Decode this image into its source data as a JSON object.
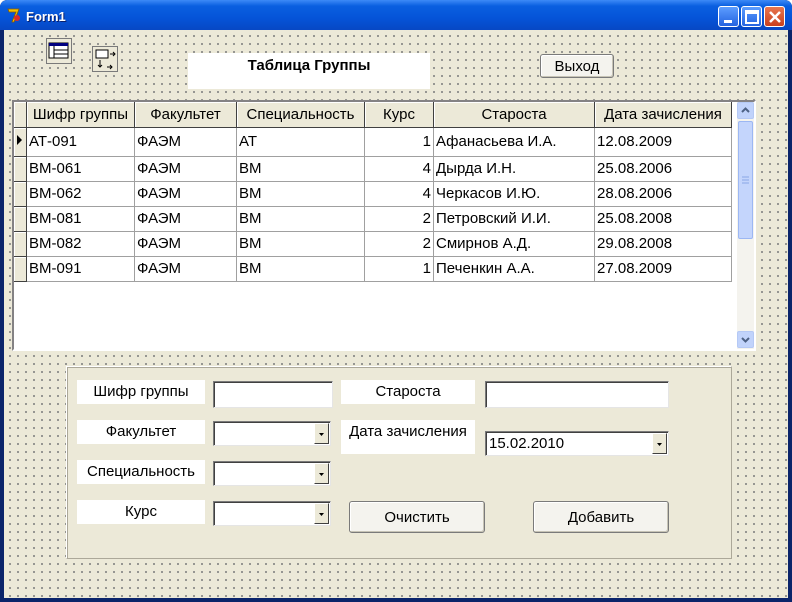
{
  "window": {
    "title": "Form1"
  },
  "toolbar": {
    "icons": [
      "table-view-icon",
      "swap-arrows-icon"
    ]
  },
  "header": {
    "title": "Таблица Группы",
    "exit_label": "Выход"
  },
  "grid": {
    "columns": [
      "Шифр группы",
      "Факультет",
      "Специальность",
      "Курс",
      "Староста",
      "Дата зачисления"
    ],
    "rows": [
      [
        "АТ-091",
        "ФАЭМ",
        "АТ",
        "1",
        "Афанасьева И.А.",
        "12.08.2009"
      ],
      [
        "ВМ-061",
        "ФАЭМ",
        "ВМ",
        "4",
        "Дырда И.Н.",
        "25.08.2006"
      ],
      [
        "ВМ-062",
        "ФАЭМ",
        "ВМ",
        "4",
        "Черкасов И.Ю.",
        "28.08.2006"
      ],
      [
        "ВМ-081",
        "ФАЭМ",
        "ВМ",
        "2",
        "Петровский И.И.",
        "25.08.2008"
      ],
      [
        "ВМ-082",
        "ФАЭМ",
        "ВМ",
        "2",
        "Смирнов А.Д.",
        "29.08.2008"
      ],
      [
        "ВМ-091",
        "ФАЭМ",
        "ВМ",
        "1",
        "Печенкин А.А.",
        "27.08.2009"
      ]
    ],
    "selected_row": 0
  },
  "form": {
    "code_label": "Шифр группы",
    "code_value": "",
    "faculty_label": "Факультет",
    "faculty_value": "",
    "specialty_label": "Специальность",
    "specialty_value": "",
    "course_label": "Курс",
    "course_value": "",
    "head_label": "Староста",
    "head_value": "",
    "date_label": "Дата зачисления",
    "date_value": "15.02.2010",
    "clear_label": "Очистить",
    "add_label": "Добавить"
  }
}
